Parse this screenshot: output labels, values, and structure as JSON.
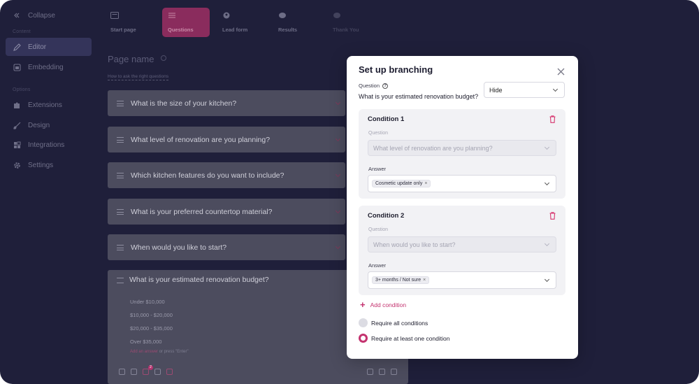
{
  "sidebar": {
    "collapse_label": "Collapse",
    "section_content": "Content",
    "section_options": "Options",
    "items_content": [
      {
        "label": "Editor",
        "icon": "pencil-icon",
        "active": true
      },
      {
        "label": "Embedding",
        "icon": "embed-icon",
        "active": false
      }
    ],
    "items_options": [
      {
        "label": "Extensions",
        "icon": "puzzle-icon"
      },
      {
        "label": "Design",
        "icon": "brush-icon"
      },
      {
        "label": "Integrations",
        "icon": "integrations-icon"
      },
      {
        "label": "Settings",
        "icon": "gear-icon"
      }
    ]
  },
  "steps": [
    {
      "label": "Start page",
      "icon": "start-page-icon"
    },
    {
      "label": "Questions",
      "icon": "list-icon",
      "active": true
    },
    {
      "label": "Lead form",
      "icon": "user-icon"
    },
    {
      "label": "Results",
      "icon": "results-icon"
    },
    {
      "label": "Thank You",
      "icon": "thank-you-icon"
    }
  ],
  "editor": {
    "page_title": "Page name",
    "hint_link": "How to ask the right questions",
    "questions": [
      "What is the size of your kitchen?",
      "What level of renovation are you planning?",
      "Which kitchen features do you want to include?",
      "What is your preferred countertop material?",
      "When would you like to start?"
    ],
    "expanded_question": {
      "title": "What is your estimated renovation budget?",
      "options": [
        "Under $10,000",
        "$10,000 - $20,000",
        "$20,000 - $35,000",
        "Over $35,000"
      ],
      "add_answer": "Add an answer",
      "add_answer_suffix": "or press \"Enter\"",
      "badge_count": "2"
    }
  },
  "modal": {
    "title": "Set up branching",
    "question_label": "Question",
    "question_value": "What is your estimated renovation budget?",
    "action_value": "Hide",
    "conditions": [
      {
        "title": "Condition 1",
        "question_label": "Question",
        "question_value": "What level of renovation are you planning?",
        "answer_label": "Answer",
        "answer_chip": "Cosmetic update only"
      },
      {
        "title": "Condition 2",
        "question_label": "Question",
        "question_value": "When would you like to start?",
        "answer_label": "Answer",
        "answer_chip": "3+ months / Not sure"
      }
    ],
    "add_condition": "Add condition",
    "radio_all": "Require all conditions",
    "radio_any": "Require at least one condition",
    "selected_rule": "Require at least one condition"
  },
  "colors": {
    "background": "#1f1f3a",
    "accent": "#c4336f",
    "active_step": "#8a2c5d"
  }
}
